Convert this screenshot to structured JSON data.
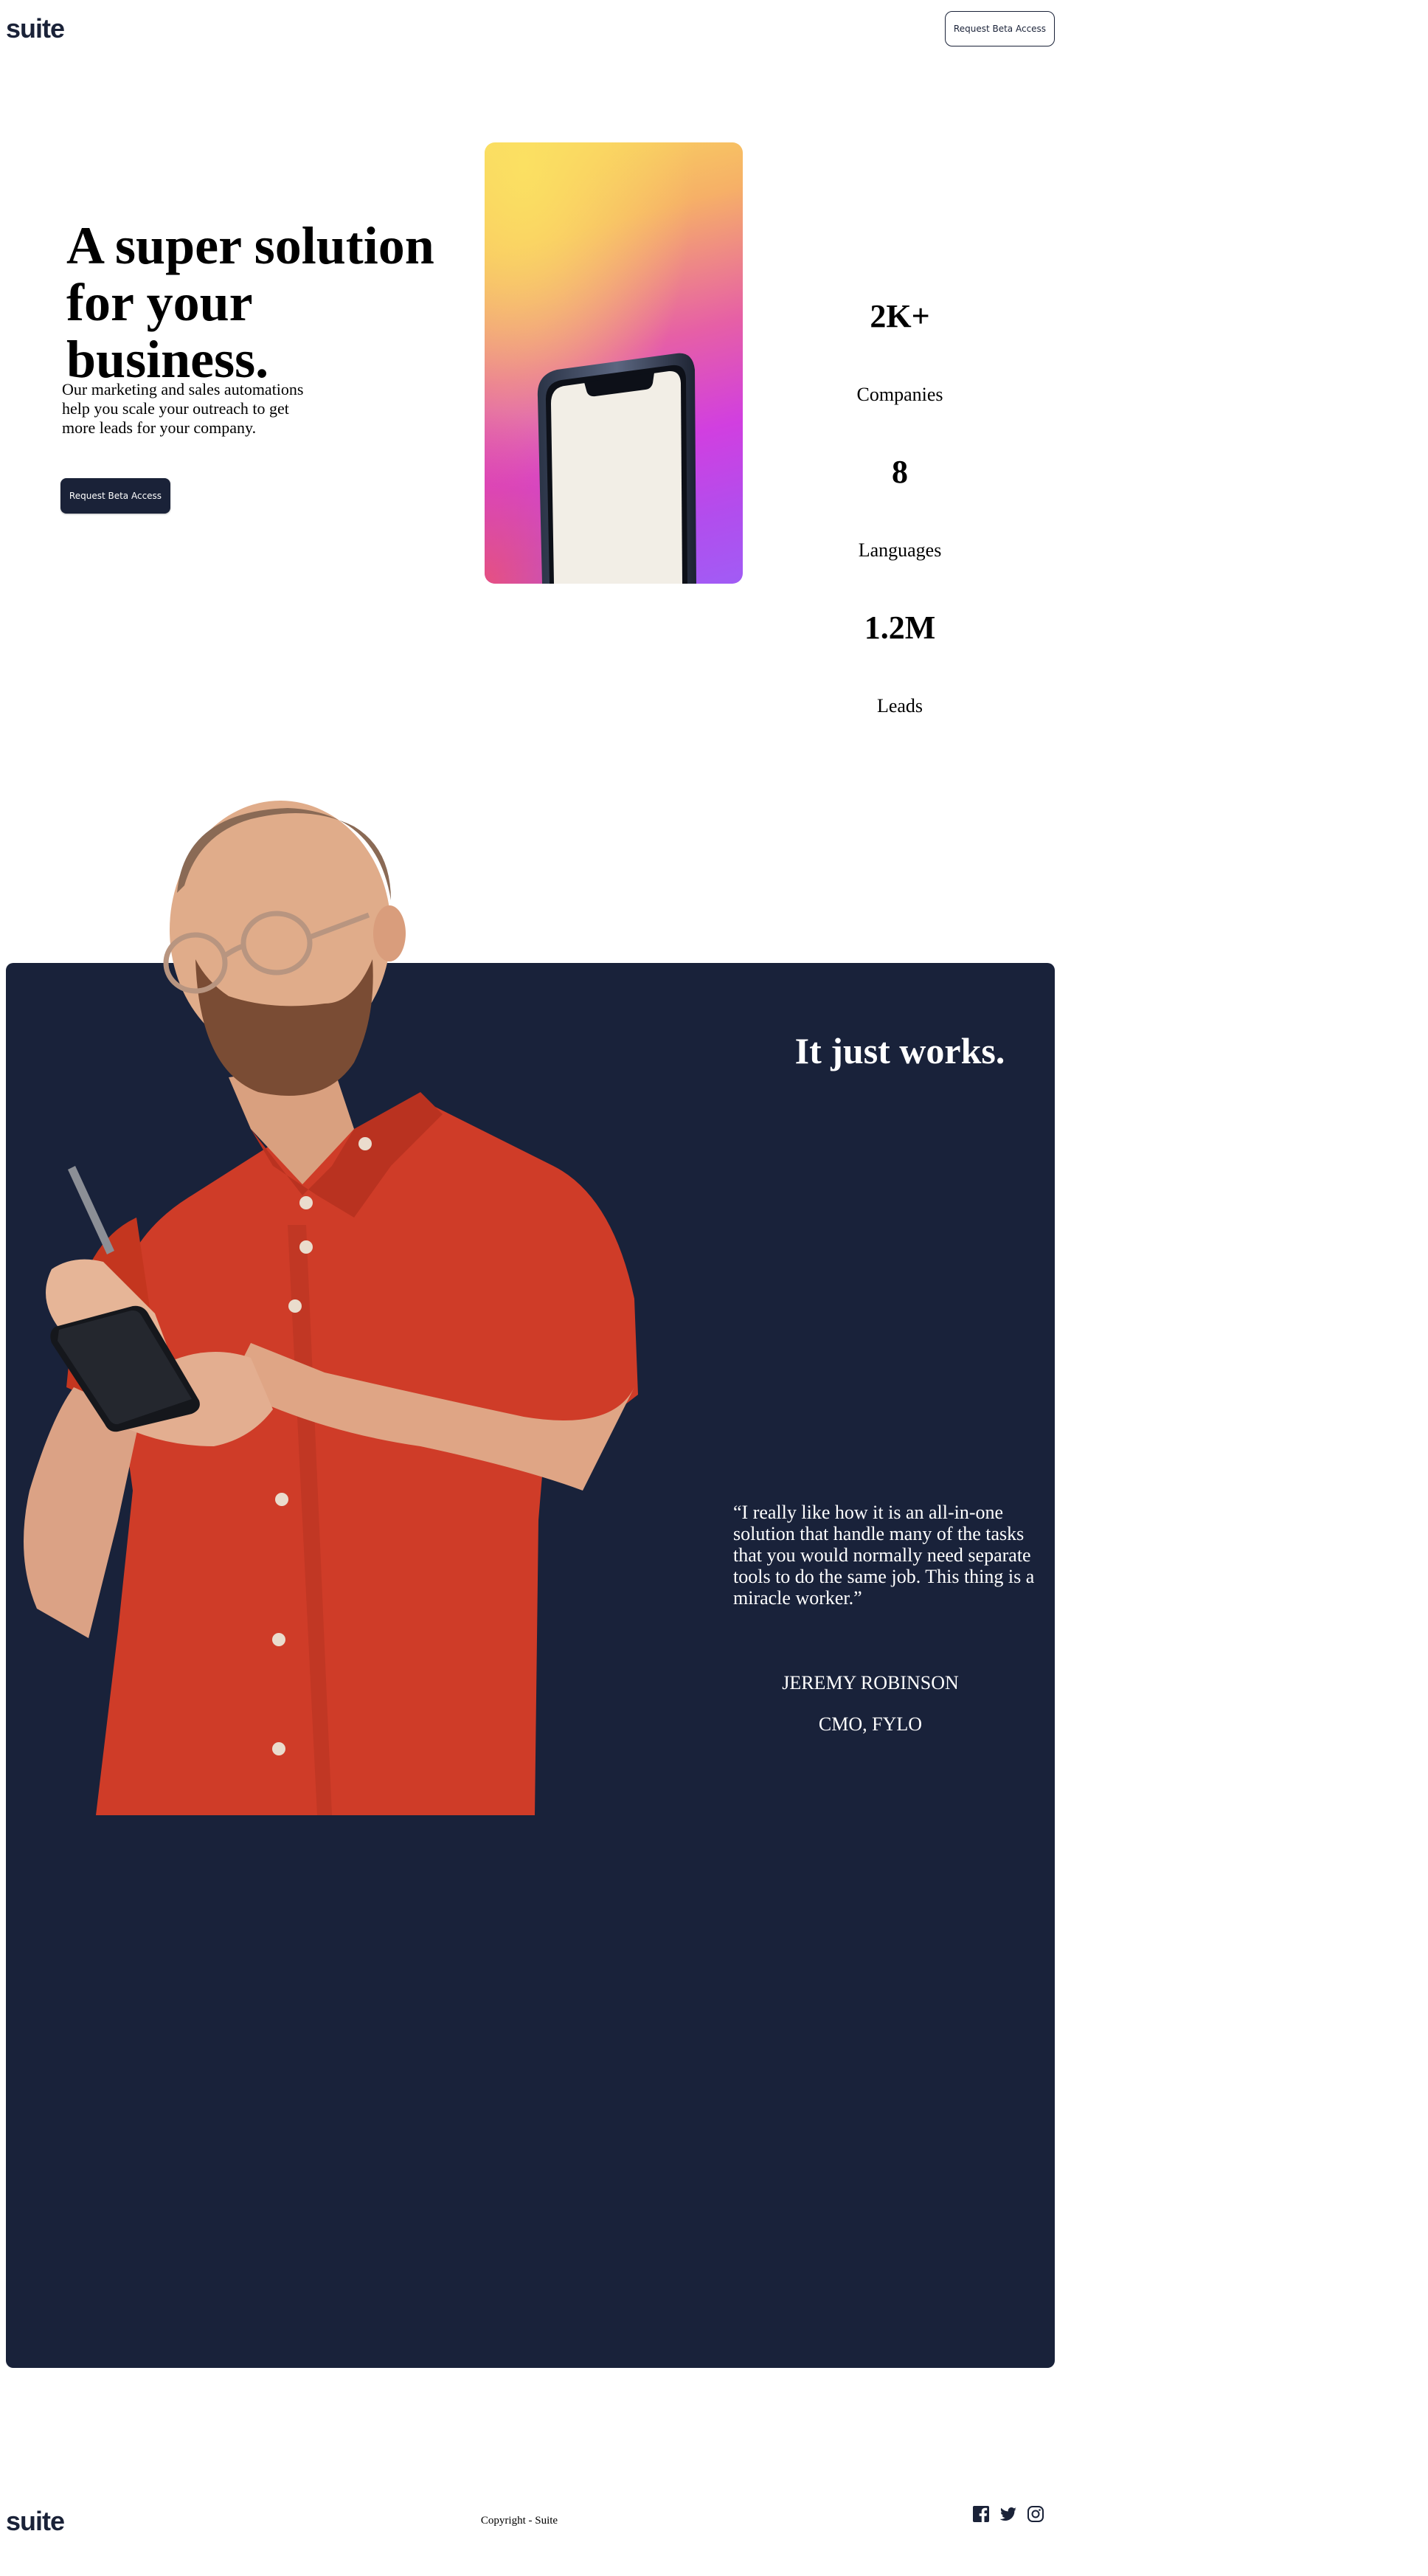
{
  "header": {
    "logo": "suite",
    "cta_label": "Request Beta Access"
  },
  "hero": {
    "title_line1": "A super solution",
    "title_line2": "for your business.",
    "description": "Our marketing and sales automations help you scale your outreach to get more leads for your company.",
    "cta_label": "Request Beta Access"
  },
  "stats": [
    {
      "value": "2K+",
      "label": "Companies"
    },
    {
      "value": "8",
      "label": "Languages"
    },
    {
      "value": "1.2M",
      "label": "Leads"
    }
  ],
  "testimonial": {
    "title": "It just works.",
    "quote": "“I really like how it is an all-in-one solution that handle many of the tasks that you would normally need separate tools to do the same job. This thing is a miracle worker.”",
    "author": "JEREMY ROBINSON",
    "role": "CMO, FYLO"
  },
  "footer": {
    "logo": "suite",
    "copyright": "Copyright - Suite",
    "social_icons": [
      "facebook-icon",
      "twitter-icon",
      "instagram-icon"
    ]
  },
  "colors": {
    "navy": "#19223a",
    "shirt": "#cf3c28"
  }
}
